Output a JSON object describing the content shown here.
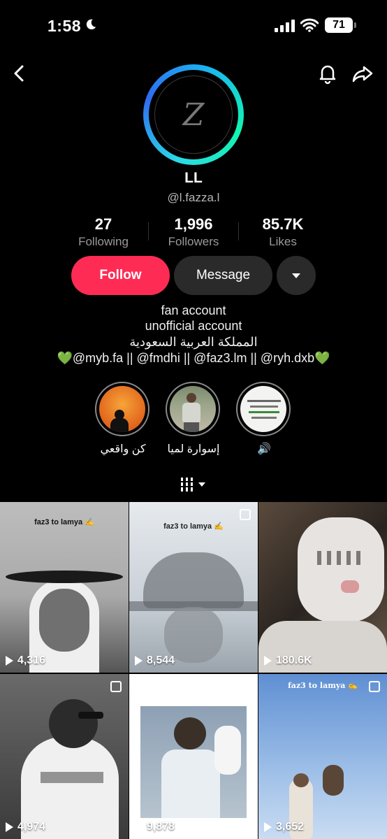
{
  "status_bar": {
    "time": "1:58",
    "battery": "71"
  },
  "profile": {
    "avatar_letter": "Z",
    "display_name": "LL",
    "username": "@l.fazza.l"
  },
  "stats": [
    {
      "value": "27",
      "label": "Following"
    },
    {
      "value": "1,996",
      "label": "Followers"
    },
    {
      "value": "85.7K",
      "label": "Likes"
    }
  ],
  "actions": {
    "follow_label": "Follow",
    "message_label": "Message"
  },
  "bio": {
    "line1": "fan account",
    "line2": "unofficial account",
    "line3": "المملكة العربية السعودية",
    "line4": "💚@myb.fa || @fmdhi || @faz3.lm || @ryh.dxb💚"
  },
  "highlights": [
    {
      "label": "كن واقعي"
    },
    {
      "label": "إسوارة لميا"
    },
    {
      "label": "🔊"
    }
  ],
  "videos": [
    {
      "views": "4,316",
      "caption": "faz3 to lamya ✍️"
    },
    {
      "views": "8,544",
      "caption": "faz3 to lamya ✍️"
    },
    {
      "views": "180.6K",
      "caption": ""
    },
    {
      "views": "4,974",
      "caption": ""
    },
    {
      "views": "9,878",
      "caption": ""
    },
    {
      "views": "3,652",
      "caption": "faz3 to lamya ✍️"
    }
  ],
  "colors": {
    "follow": "#fe2c55",
    "ring_a": "#2bd9e7",
    "ring_b": "#2f6cf0"
  }
}
